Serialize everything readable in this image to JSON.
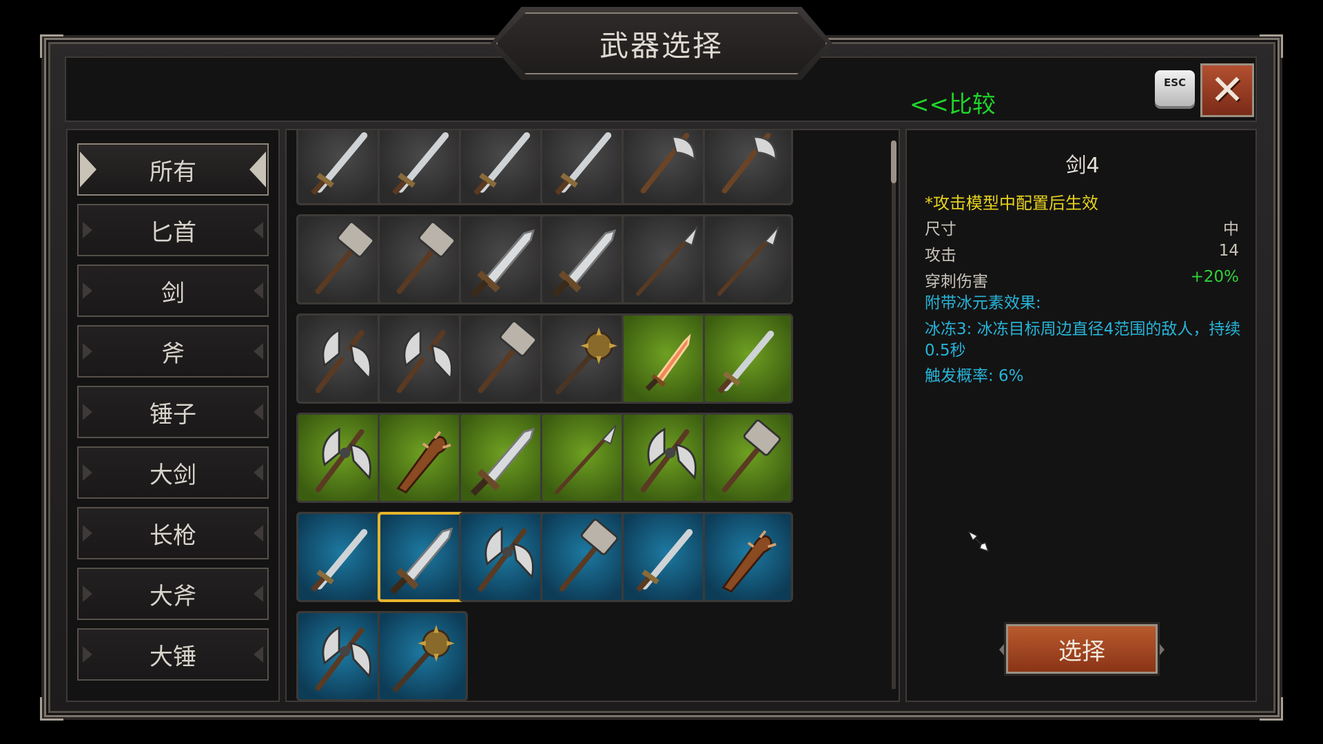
{
  "title": "武器选择",
  "header": {
    "compare_label": "<<比较",
    "esc_label": "ESC",
    "close_label": "✕"
  },
  "categories": [
    {
      "label": "所有",
      "active": true
    },
    {
      "label": "匕首",
      "active": false
    },
    {
      "label": "剑",
      "active": false
    },
    {
      "label": "斧",
      "active": false
    },
    {
      "label": "锤子",
      "active": false
    },
    {
      "label": "大剑",
      "active": false
    },
    {
      "label": "长枪",
      "active": false
    },
    {
      "label": "大斧",
      "active": false
    },
    {
      "label": "大锤",
      "active": false
    }
  ],
  "weapons": [
    {
      "icon": "sword-icon",
      "rarity": "gray"
    },
    {
      "icon": "sword-icon",
      "rarity": "gray"
    },
    {
      "icon": "sword-icon",
      "rarity": "gray"
    },
    {
      "icon": "sword-icon",
      "rarity": "gray"
    },
    {
      "icon": "axe-icon",
      "rarity": "gray"
    },
    {
      "icon": "axe-icon",
      "rarity": "gray"
    },
    {
      "icon": "hammer-icon",
      "rarity": "gray"
    },
    {
      "icon": "hammer-icon",
      "rarity": "gray"
    },
    {
      "icon": "greatsword-icon",
      "rarity": "gray"
    },
    {
      "icon": "greatsword-icon",
      "rarity": "gray"
    },
    {
      "icon": "spear-icon",
      "rarity": "gray"
    },
    {
      "icon": "spear-icon",
      "rarity": "gray"
    },
    {
      "icon": "greataxe-icon",
      "rarity": "gray"
    },
    {
      "icon": "greataxe-icon",
      "rarity": "gray"
    },
    {
      "icon": "hammer-icon",
      "rarity": "gray"
    },
    {
      "icon": "mace-icon",
      "rarity": "gray"
    },
    {
      "icon": "dagger-icon",
      "rarity": "green"
    },
    {
      "icon": "sword-icon",
      "rarity": "green"
    },
    {
      "icon": "greataxe-icon",
      "rarity": "green"
    },
    {
      "icon": "club-icon",
      "rarity": "green"
    },
    {
      "icon": "greatsword-icon",
      "rarity": "green"
    },
    {
      "icon": "spear-icon",
      "rarity": "green"
    },
    {
      "icon": "greataxe-icon",
      "rarity": "green"
    },
    {
      "icon": "hammer-icon",
      "rarity": "green"
    },
    {
      "icon": "sword-icon",
      "rarity": "blue"
    },
    {
      "icon": "greatsword-icon",
      "rarity": "blue",
      "selected": true
    },
    {
      "icon": "greataxe-icon",
      "rarity": "blue"
    },
    {
      "icon": "hammer-icon",
      "rarity": "blue"
    },
    {
      "icon": "sword-icon",
      "rarity": "blue"
    },
    {
      "icon": "club-icon",
      "rarity": "blue"
    },
    {
      "icon": "greataxe-icon",
      "rarity": "blue"
    },
    {
      "icon": "mace-icon",
      "rarity": "blue"
    }
  ],
  "details": {
    "name": "剑4",
    "note": "*攻击模型中配置后生效",
    "stats": [
      {
        "label": "尺寸",
        "value": "中",
        "color": "#c9c4ba"
      },
      {
        "label": "攻击",
        "value": "14",
        "color": "#c9c4ba"
      },
      {
        "label": "穿刺伤害",
        "value": "+20%",
        "color": "#2ed23a"
      }
    ],
    "effect_title": "附带冰元素效果:",
    "effect_desc": "冰冻3: 冰冻目标周边直径4范围的敌人，持续0.5秒",
    "trigger": "触发概率: 6%"
  },
  "select_label": "选择",
  "colors": {
    "accent_gold": "#e7b52c",
    "compare_green": "#1ed52a",
    "note_yellow": "#e6d21e",
    "effect_cyan": "#27b4d8",
    "button_orange": "#b95a2e"
  }
}
